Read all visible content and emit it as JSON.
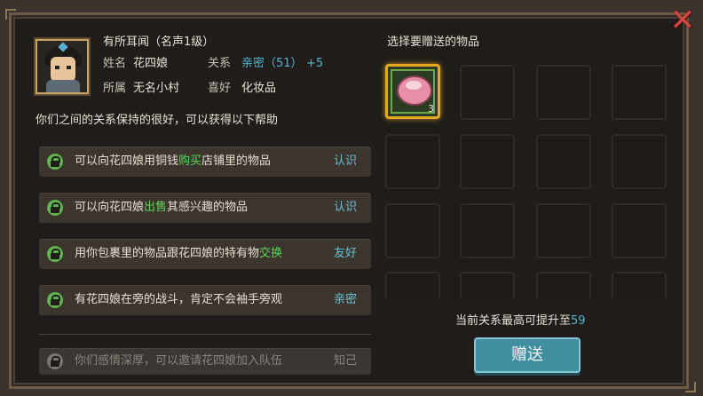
{
  "close_icon": "✕",
  "npc": {
    "title": "有所耳闻（名声1级）",
    "name_label": "姓名",
    "name": "花四娘",
    "relation_label": "关系",
    "relation_value": "亲密（51）",
    "relation_bonus": "+5",
    "origin_label": "所属",
    "origin": "无名小村",
    "hobby_label": "喜好",
    "hobby": "化妆品"
  },
  "relation_desc": "你们之间的关系保持的很好，可以获得以下帮助",
  "perks": [
    {
      "pre": "可以向花四娘用铜钱",
      "hl": "购买",
      "post": "店铺里的物品",
      "level": "认识",
      "enabled": true
    },
    {
      "pre": "可以向花四娘",
      "hl": "出售",
      "post": "其感兴趣的物品",
      "level": "认识",
      "enabled": true
    },
    {
      "pre": "用你包裹里的物品跟花四娘的特有物",
      "hl": "交换",
      "post": "",
      "level": "友好",
      "enabled": true
    },
    {
      "pre": "有花四娘在旁的战斗，肯定不会袖手旁观",
      "hl": "",
      "post": "",
      "level": "亲密",
      "enabled": true
    },
    {
      "pre": "你们感情深厚，可以邀请花四娘加入队伍",
      "hl": "",
      "post": "",
      "level": "知己",
      "enabled": false
    }
  ],
  "gift_panel": {
    "title": "选择要赠送的物品",
    "selected_item_qty": "3",
    "max_label": "当前关系最高可提升至",
    "max_value": "59",
    "give_label": "赠送"
  },
  "colors": {
    "accent_blue": "#55b6cf",
    "highlight_green": "#5fd35a",
    "select_gold": "#e8a625",
    "close_red": "#d2473f"
  }
}
